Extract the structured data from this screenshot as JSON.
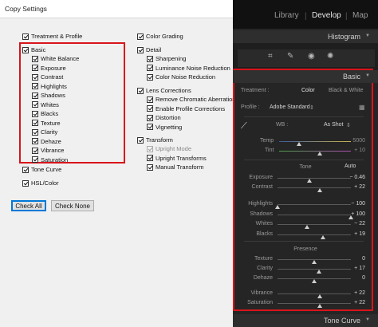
{
  "dialog": {
    "title": "Copy Settings",
    "left": {
      "treatment": "Treatment & Profile",
      "basic": "Basic",
      "basic_items": [
        "White Balance",
        "Exposure",
        "Contrast",
        "Highlights",
        "Shadows",
        "Whites",
        "Blacks",
        "Texture",
        "Clarity",
        "Dehaze",
        "Vibrance",
        "Saturation"
      ],
      "tone_curve": "Tone Curve",
      "hsl": "HSL/Color"
    },
    "right": {
      "color_grading": "Color Grading",
      "detail": "Detail",
      "detail_items": [
        "Sharpening",
        "Luminance Noise Reduction",
        "Color Noise Reduction"
      ],
      "lens": "Lens Corrections",
      "lens_items": [
        "Remove Chromatic Aberration",
        "Enable Profile Corrections",
        "Distortion",
        "Vignetting"
      ],
      "transform": "Transform",
      "transform_items": [
        {
          "label": "Upright Mode",
          "disabled": true
        },
        {
          "label": "Upright Transforms",
          "disabled": false
        },
        {
          "label": "Manual Transform",
          "disabled": false
        }
      ]
    },
    "buttons": {
      "check_all": "Check All",
      "check_none": "Check None"
    }
  },
  "lightroom": {
    "modules": [
      "Library",
      "Develop",
      "Map"
    ],
    "active_module": "Develop",
    "histogram_label": "Histogram",
    "tools": [
      "crop-icon",
      "brush-icon",
      "redeye-icon",
      "mask-icon"
    ],
    "basic_label": "Basic",
    "treatment_label": "Treatment :",
    "treatment_options": [
      "Color",
      "Black & White"
    ],
    "profile_label": "Profile :",
    "profile_value": "Adobe Standard",
    "wb_label": "WB :",
    "wb_value": "As Shot",
    "temp": {
      "label": "Temp",
      "value": "5000"
    },
    "tint": {
      "label": "Tint",
      "value": "+ 10"
    },
    "tone_label": "Tone",
    "auto_label": "Auto",
    "tone_sliders": [
      {
        "label": "Exposure",
        "value": "− 0.46"
      },
      {
        "label": "Contrast",
        "value": "+ 22"
      }
    ],
    "tone_sliders2": [
      {
        "label": "Highlights",
        "value": "− 100"
      },
      {
        "label": "Shadows",
        "value": "+ 100"
      },
      {
        "label": "Whites",
        "value": "− 22"
      },
      {
        "label": "Blacks",
        "value": "+ 19"
      }
    ],
    "presence_label": "Presence",
    "presence_sliders": [
      {
        "label": "Texture",
        "value": "0"
      },
      {
        "label": "Clarity",
        "value": "+ 17"
      },
      {
        "label": "Dehaze",
        "value": "0"
      }
    ],
    "presence_sliders2": [
      {
        "label": "Vibrance",
        "value": "+ 22"
      },
      {
        "label": "Saturation",
        "value": "+ 22"
      }
    ],
    "tone_curve_label": "Tone Curve",
    "accent_red": "#d9141b"
  }
}
